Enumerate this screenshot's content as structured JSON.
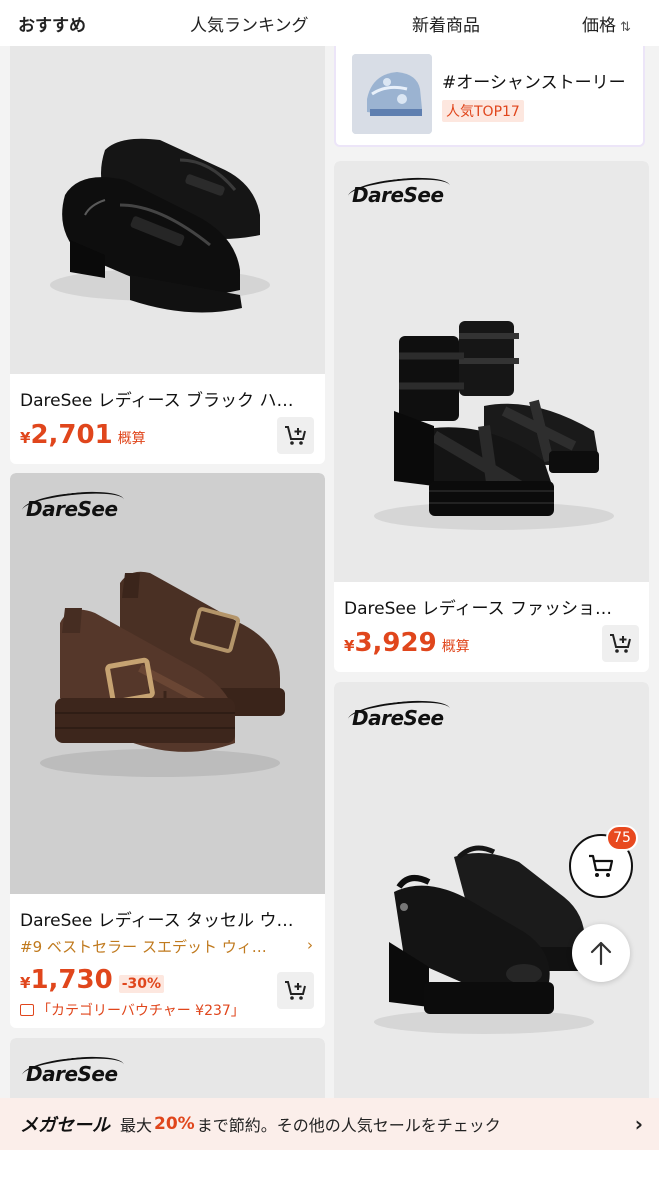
{
  "tabs": {
    "recommended": "おすすめ",
    "ranking": "人気ランキング",
    "new": "新着商品",
    "price": "価格",
    "sort_icon": "⇅"
  },
  "featured": {
    "hashtag": "#オーシャンストーリー",
    "badge": "人気TOP17"
  },
  "products": [
    {
      "title": "DareSee レディース ブラック ハ…",
      "yen": "¥",
      "price": "2,701",
      "approx": "概算"
    },
    {
      "brand": "DareSee",
      "title": "DareSee レディース ファッショ…",
      "yen": "¥",
      "price": "3,929",
      "approx": "概算"
    },
    {
      "brand": "DareSee",
      "title": "DareSee レディース タッセル ウ…",
      "rank": "#9 ベストセラー スエデット ウィ…",
      "rank_chevron": "›",
      "yen": "¥",
      "price": "1,730",
      "discount": "-30%",
      "voucher": "「カテゴリーバウチャー ¥237」"
    },
    {
      "brand": "DareSee"
    },
    {
      "brand": "DareSee"
    }
  ],
  "cart_count": "75",
  "banner": {
    "mega": "メガセール",
    "prefix": "最大",
    "percent": "20%",
    "suffix": "まで節約。その他の人気セールをチェック",
    "chevron": "›"
  },
  "icons": {
    "cart": "cart-plus-icon",
    "float_cart": "shopping-cart-icon",
    "top": "arrow-up-icon"
  },
  "colors": {
    "accent": "#e0461c",
    "rank": "#c07a1e"
  }
}
